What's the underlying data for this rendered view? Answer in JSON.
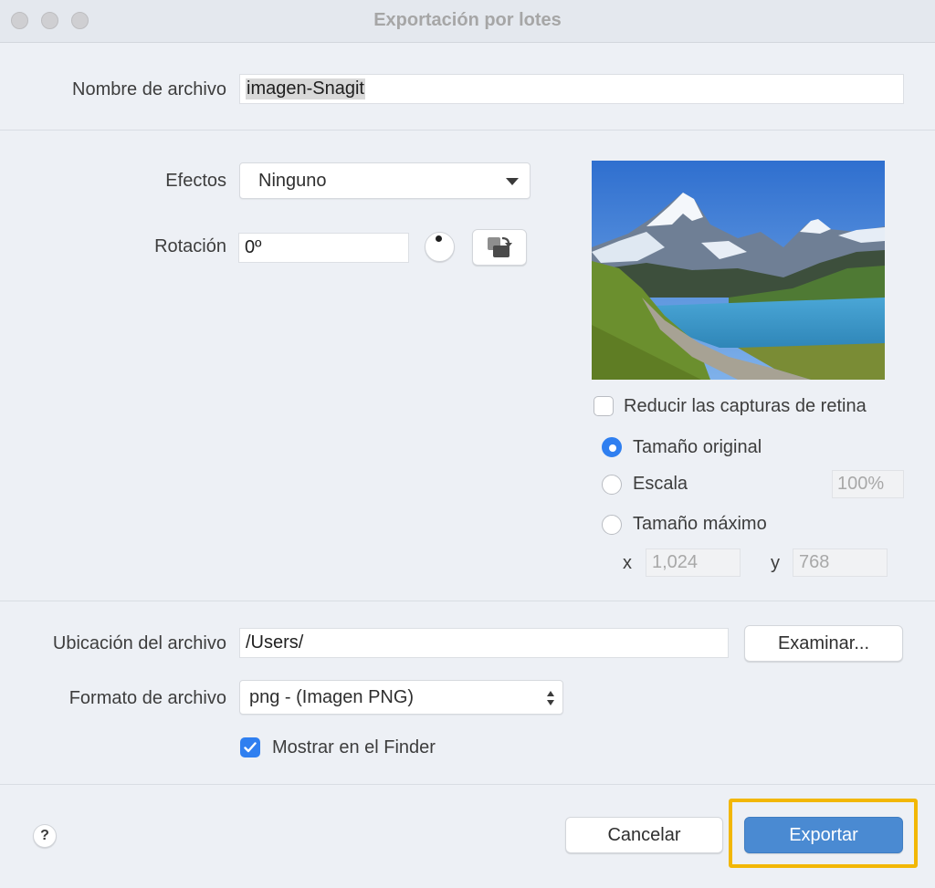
{
  "window": {
    "title": "Exportación por lotes"
  },
  "filename": {
    "label": "Nombre de archivo",
    "value": "imagen-Snagit"
  },
  "effects": {
    "label": "Efectos",
    "selected": "Ninguno"
  },
  "rotation": {
    "label": "Rotación",
    "value": "0º"
  },
  "preview": {
    "icon": "mountain-lake-photo"
  },
  "retina": {
    "label": "Reducir las capturas de retina",
    "checked": false
  },
  "size": {
    "original_label": "Tamaño original",
    "scale_label": "Escala",
    "scale_value": "100%",
    "max_label": "Tamaño máximo",
    "x_label": "x",
    "x_value": "1,024",
    "y_label": "y",
    "y_value": "768",
    "selected": "original"
  },
  "location": {
    "label": "Ubicación del archivo",
    "value": "/Users/",
    "browse_label": "Examinar..."
  },
  "format": {
    "label": "Formato de archivo",
    "selected": "png - (Imagen PNG)"
  },
  "finder": {
    "label": "Mostrar en el Finder",
    "checked": true
  },
  "footer": {
    "help_label": "?",
    "cancel_label": "Cancelar",
    "export_label": "Exportar"
  },
  "colors": {
    "accent": "#2f7ff0",
    "primary_button": "#4a8ad2",
    "highlight": "#f2b705"
  }
}
